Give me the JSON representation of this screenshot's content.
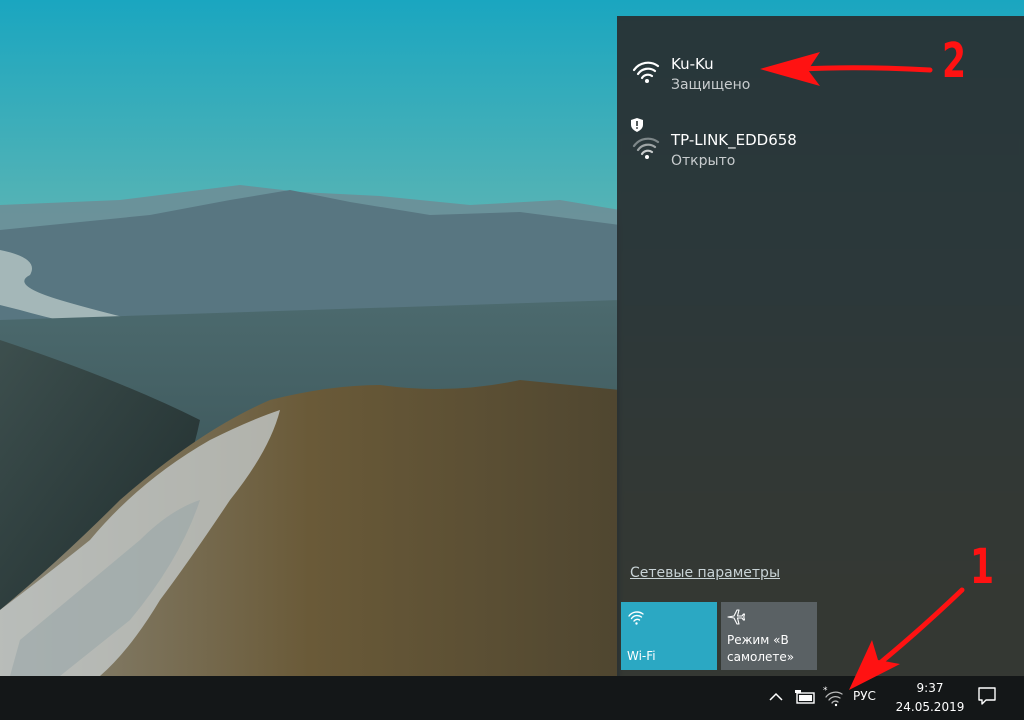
{
  "colors": {
    "flyout_bg": "#283032",
    "wifi_tile": "#2ba8c3",
    "airplane_tile": "#5a6164",
    "taskbar": "#141718",
    "annotation_red": "#ff1212"
  },
  "networks": [
    {
      "name": "Ku-Ku",
      "status": "Защищено",
      "icon": "wifi-icon",
      "secure": true
    },
    {
      "name": "TP-LINK_EDD658",
      "status": "Открыто",
      "icon": "wifi-open-icon",
      "secure": false
    }
  ],
  "flyout": {
    "settings_link": "Сетевые параметры",
    "tiles": {
      "wifi": {
        "label": "Wi-Fi",
        "icon": "wifi-icon",
        "active": true
      },
      "airplane": {
        "label_line1": "Режим «В",
        "label_line2": "самолете»",
        "icon": "airplane-icon",
        "active": false
      }
    }
  },
  "taskbar": {
    "language": "РУС",
    "time": "9:37",
    "date": "24.05.2019"
  },
  "annotations": {
    "label_1": "1",
    "label_2": "2"
  }
}
